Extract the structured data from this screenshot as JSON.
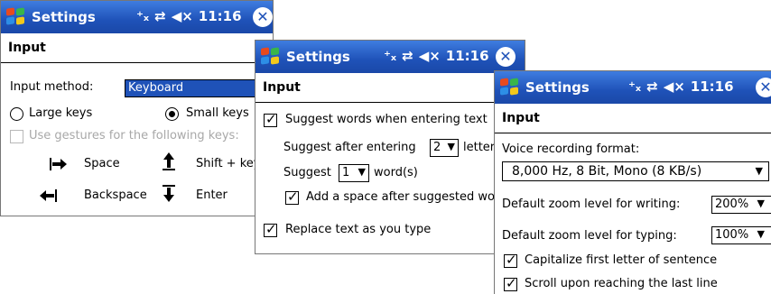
{
  "windows": [
    {
      "title": "Settings",
      "status_icons": [
        "connectivity-icon",
        "sync-icon",
        "volume-icon"
      ],
      "time": "11:16",
      "section": "Input",
      "input_method_label": "Input method:",
      "input_method_value": "Keyboard",
      "large_keys_label": "Large keys",
      "small_keys_label": "Small keys",
      "small_keys_selected": true,
      "gestures_label": "Use gestures for the following keys:",
      "gestures_enabled": false,
      "gestures": [
        {
          "icon": "arrow-right-icon",
          "label": "Space"
        },
        {
          "icon": "arrow-up-icon",
          "label": "Shift + key"
        },
        {
          "icon": "arrow-left-icon",
          "label": "Backspace"
        },
        {
          "icon": "arrow-down-icon",
          "label": "Enter"
        }
      ]
    },
    {
      "title": "Settings",
      "time": "11:16",
      "section": "Input",
      "suggest_words_label": "Suggest words when entering text",
      "suggest_words_checked": true,
      "suggest_after_label": "Suggest after entering",
      "suggest_after_value": "2",
      "suggest_after_unit": "letter",
      "suggest_label": "Suggest",
      "suggest_count_value": "1",
      "suggest_count_unit": "word(s)",
      "add_space_label": "Add a space after suggested wo",
      "add_space_checked": true,
      "replace_text_label": "Replace text as you type",
      "replace_text_checked": true
    },
    {
      "title": "Settings",
      "time": "11:16",
      "section": "Input",
      "voice_format_label": "Voice recording format:",
      "voice_format_value": "8,000 Hz, 8 Bit, Mono (8 KB/s)",
      "zoom_writing_label": "Default zoom level for writing:",
      "zoom_writing_value": "200%",
      "zoom_typing_label": "Default zoom level for typing:",
      "zoom_typing_value": "100%",
      "capitalize_label": "Capitalize first letter of sentence",
      "capitalize_checked": true,
      "scroll_label": "Scroll upon reaching the last line",
      "scroll_checked": true
    }
  ]
}
